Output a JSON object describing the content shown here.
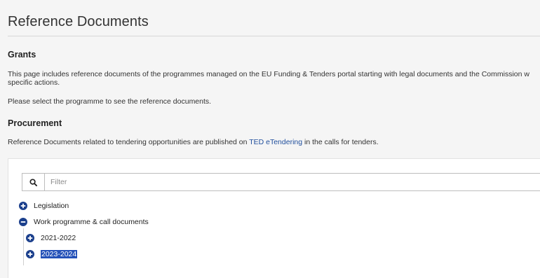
{
  "page": {
    "title": "Reference Documents"
  },
  "grants": {
    "heading": "Grants",
    "paragraph_line1": "This page includes reference documents of the programmes managed on the EU Funding & Tenders portal starting with legal documents and the Commission w",
    "paragraph_line2": "specific actions.",
    "instruction": "Please select the programme to see the reference documents."
  },
  "procurement": {
    "heading": "Procurement",
    "text_before_link": "Reference Documents related to tendering opportunities are published on ",
    "link_text": "TED eTendering",
    "text_after_link": " in the calls for tenders."
  },
  "filter": {
    "placeholder": "Filter",
    "value": ""
  },
  "tree": {
    "items": [
      {
        "label": "Legislation",
        "state": "collapsed"
      },
      {
        "label": "Work programme & call documents",
        "state": "expanded"
      },
      {
        "label": "2021-2022",
        "state": "collapsed"
      },
      {
        "label": "2023-2024",
        "state": "collapsed",
        "selected": true
      }
    ]
  },
  "colors": {
    "tree_toggle": "#1b3f8c",
    "link": "#1f4e9c",
    "selection": "#2451b8"
  },
  "icons": {
    "filter_button": "search-icon",
    "collapsed": "plus-circle-icon",
    "expanded": "minus-circle-icon"
  }
}
